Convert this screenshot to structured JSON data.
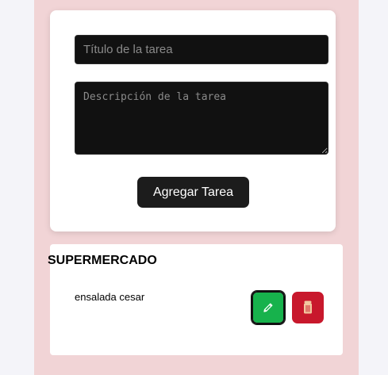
{
  "form": {
    "title_placeholder": "Título de la tarea",
    "description_placeholder": "Descripción de la tarea",
    "add_button_label": "Agregar Tarea"
  },
  "task_list": {
    "category": "SUPERMERCADO",
    "tasks": [
      {
        "text": "ensalada cesar",
        "edit_icon": "pencil-icon",
        "delete_icon": "trash-icon"
      }
    ]
  },
  "colors": {
    "page_background": "#f4f4f9",
    "column_background": "#f1d4d6",
    "input_background": "#111111",
    "button_dark": "#1c1c1c",
    "edit_green": "#17b24c",
    "delete_red": "#c8182c"
  }
}
